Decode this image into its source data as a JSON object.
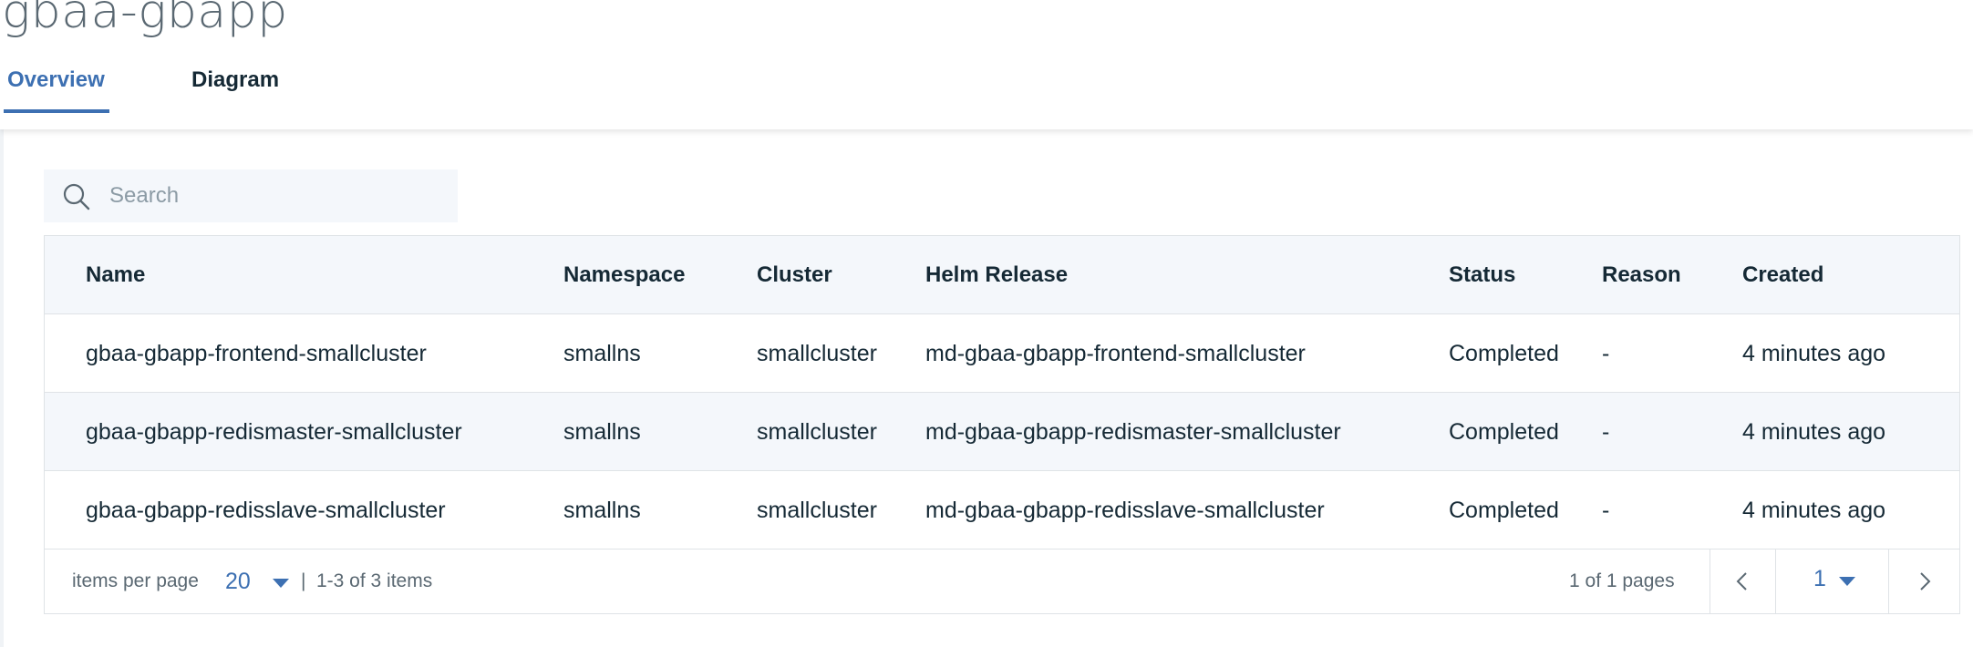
{
  "page": {
    "title": "gbaa-gbapp",
    "tabs": [
      {
        "label": "Overview",
        "active": true
      },
      {
        "label": "Diagram",
        "active": false
      }
    ]
  },
  "search": {
    "placeholder": "Search",
    "value": "",
    "icon": "search-icon"
  },
  "table": {
    "columns": [
      "Name",
      "Namespace",
      "Cluster",
      "Helm Release",
      "Status",
      "Reason",
      "Created"
    ],
    "rows": [
      {
        "name": "gbaa-gbapp-frontend-smallcluster",
        "namespace": "smallns",
        "cluster": "smallcluster",
        "helm_release": "md-gbaa-gbapp-frontend-smallcluster",
        "status": "Completed",
        "reason": "-",
        "created": "4 minutes ago"
      },
      {
        "name": "gbaa-gbapp-redismaster-smallcluster",
        "namespace": "smallns",
        "cluster": "smallcluster",
        "helm_release": "md-gbaa-gbapp-redismaster-smallcluster",
        "status": "Completed",
        "reason": "-",
        "created": "4 minutes ago"
      },
      {
        "name": "gbaa-gbapp-redisslave-smallcluster",
        "namespace": "smallns",
        "cluster": "smallcluster",
        "helm_release": "md-gbaa-gbapp-redisslave-smallcluster",
        "status": "Completed",
        "reason": "-",
        "created": "4 minutes ago"
      }
    ]
  },
  "pagination": {
    "items_per_page_label": "items per page",
    "items_per_page_value": "20",
    "separator": "|",
    "range_text": "1-3 of 3 items",
    "pages_text": "1 of 1 pages",
    "current_page": "1",
    "prev_icon": "chevron-left-icon",
    "next_icon": "chevron-right-icon"
  },
  "colors": {
    "accent": "#3d70b2",
    "header_bg": "#f4f7fb",
    "border": "#dfe3e6",
    "text": "#152935",
    "muted_text": "#5a6872"
  }
}
